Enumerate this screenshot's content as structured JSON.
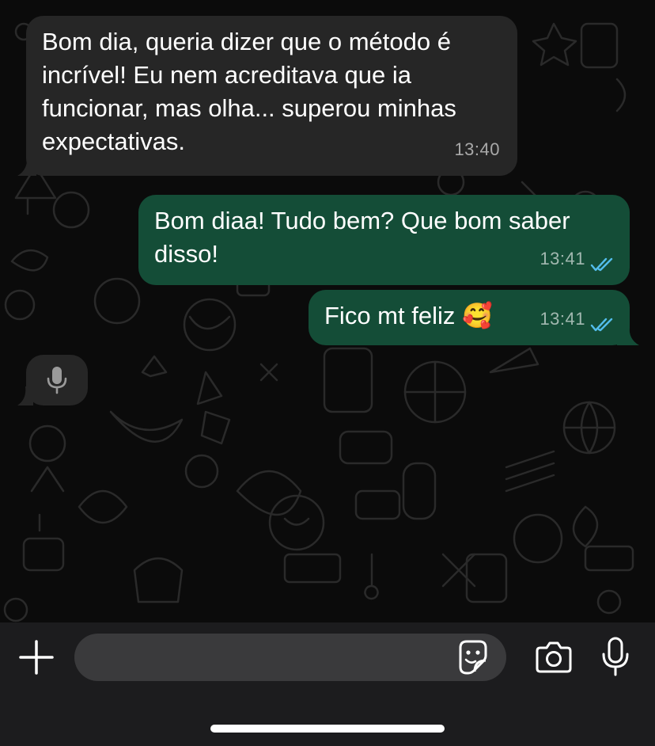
{
  "messages": [
    {
      "direction": "incoming",
      "text": "Bom dia, queria dizer que o método é incrível! Eu nem acreditava que ia funcionar, mas olha... superou minhas expectativas.",
      "time": "13:40"
    },
    {
      "direction": "outgoing",
      "text": "Bom diaa! Tudo bem? Que bom saber disso!",
      "time": "13:41",
      "status": "read"
    },
    {
      "direction": "outgoing",
      "text": "Fico mt feliz 🥰",
      "time": "13:41",
      "status": "read"
    }
  ],
  "voice_message": {
    "icon": "mic-icon"
  },
  "composer": {
    "placeholder": "",
    "icons": [
      "plus-icon",
      "sticker-icon",
      "camera-icon",
      "mic-icon"
    ]
  },
  "colors": {
    "background": "#0b0b0b",
    "incoming_bubble": "#262626",
    "outgoing_bubble": "#144d37",
    "read_ticks": "#53bdeb",
    "input_bar": "#1c1c1e"
  }
}
